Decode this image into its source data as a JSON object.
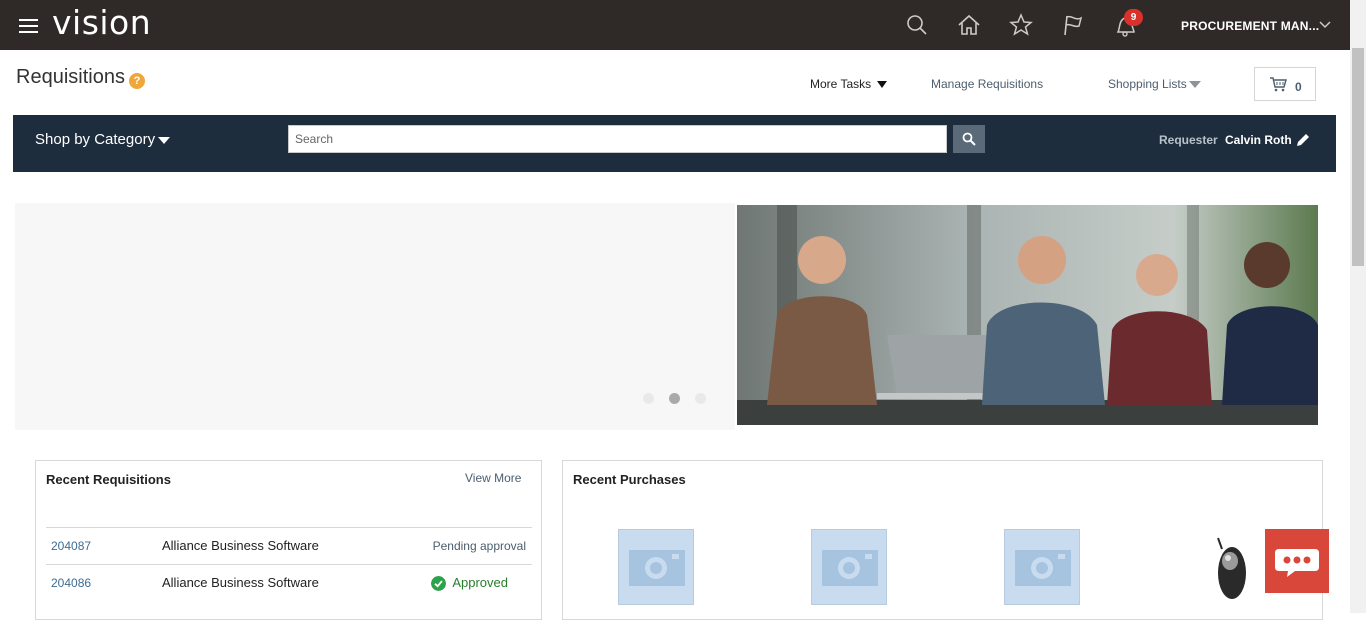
{
  "topbar": {
    "logo": "vision",
    "notification_count": "9",
    "user_menu": "PROCUREMENT MAN..."
  },
  "header": {
    "title": "Requisitions",
    "help_glyph": "?",
    "more_tasks": "More Tasks",
    "manage_requisitions": "Manage Requisitions",
    "shopping_lists": "Shopping Lists",
    "cart_count": "0"
  },
  "shopbar": {
    "shop_by_category": "Shop by Category",
    "search_placeholder": "Search",
    "requester_label": "Requester",
    "requester_name": "Calvin Roth"
  },
  "carousel": {
    "slide_count": 3,
    "active_slide": 2
  },
  "recent_requisitions": {
    "title": "Recent Requisitions",
    "view_more": "View More",
    "rows": [
      {
        "number": "204087",
        "description": "Alliance Business Software",
        "status": "Pending approval"
      },
      {
        "number": "204086",
        "description": "Alliance Business Software",
        "status": "Approved"
      }
    ]
  },
  "recent_purchases": {
    "title": "Recent Purchases"
  },
  "colors": {
    "topbar": "#2f2a27",
    "shopbar": "#1d2d3d",
    "badge": "#d9322d",
    "help": "#f0a73a",
    "chat": "#d9463a",
    "approved": "#2ca24a"
  },
  "icons": [
    "hamburger-icon",
    "search-icon",
    "home-icon",
    "star-icon",
    "flag-icon",
    "bell-icon",
    "chevron-down-icon",
    "cart-icon",
    "magnifier-icon",
    "pencil-icon",
    "camera-placeholder-icon",
    "chat-icon"
  ]
}
